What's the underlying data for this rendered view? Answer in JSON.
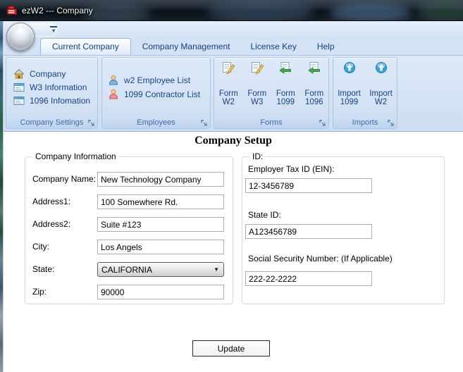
{
  "window": {
    "title": "ezW2 --- Company"
  },
  "colors": {
    "ribbon_text": "#15428b",
    "ribbon_bg": "#d3e2f5",
    "titlebar_bg": "#10161e",
    "content_bg": "#ffffff",
    "group_caption_text": "#3e6ca8"
  },
  "ribbon": {
    "tabs": [
      {
        "label": "Current Company",
        "selected": true
      },
      {
        "label": "Company Management",
        "selected": false
      },
      {
        "label": "License Key",
        "selected": false
      },
      {
        "label": "Help",
        "selected": false
      }
    ],
    "groups": [
      {
        "label": "Company Settings",
        "items": [
          {
            "label": "Company",
            "icon": "house-icon"
          },
          {
            "label": "W3 Information",
            "icon": "form-window-icon"
          },
          {
            "label": "1096 Infomation",
            "icon": "form-window-icon"
          }
        ]
      },
      {
        "label": "Employees",
        "items": [
          {
            "label": "w2 Employee List",
            "icon": "person-blue-icon"
          },
          {
            "label": "1099 Contractor List",
            "icon": "person-red-icon"
          }
        ]
      },
      {
        "label": "Forms",
        "items": [
          {
            "line1": "Form",
            "line2": "W2",
            "icon": "form-edit-icon"
          },
          {
            "line1": "Form",
            "line2": "W3",
            "icon": "form-edit-icon"
          },
          {
            "line1": "Form",
            "line2": "1099",
            "icon": "form-import-icon"
          },
          {
            "line1": "Form",
            "line2": "1096",
            "icon": "form-import-icon"
          }
        ]
      },
      {
        "label": "Imports",
        "items": [
          {
            "line1": "Import",
            "line2": "1099",
            "icon": "import-up-icon"
          },
          {
            "line1": "Import",
            "line2": "W2",
            "icon": "import-up-icon"
          }
        ]
      }
    ]
  },
  "content": {
    "heading": "Company Setup",
    "company_info": {
      "group_label": "Company Information",
      "fields": [
        {
          "label": "Company Name:",
          "value": "New Technology Company"
        },
        {
          "label": "Address1:",
          "value": "100 Somewhere Rd."
        },
        {
          "label": "Address2:",
          "value": "Suite #123"
        },
        {
          "label": "City:",
          "value": "Los Angels"
        },
        {
          "label": "State:",
          "value": "CALIFORNIA"
        },
        {
          "label": "Zip:",
          "value": "90000"
        }
      ]
    },
    "id_info": {
      "group_label": "ID:",
      "fields": [
        {
          "label": "Employer Tax ID (EIN):",
          "value": "12-3456789"
        },
        {
          "label": "State ID:",
          "value": "A123456789"
        },
        {
          "label": "Social Security Number: (If Applicable)",
          "value": "222-22-2222"
        }
      ]
    },
    "update_button": "Update"
  }
}
